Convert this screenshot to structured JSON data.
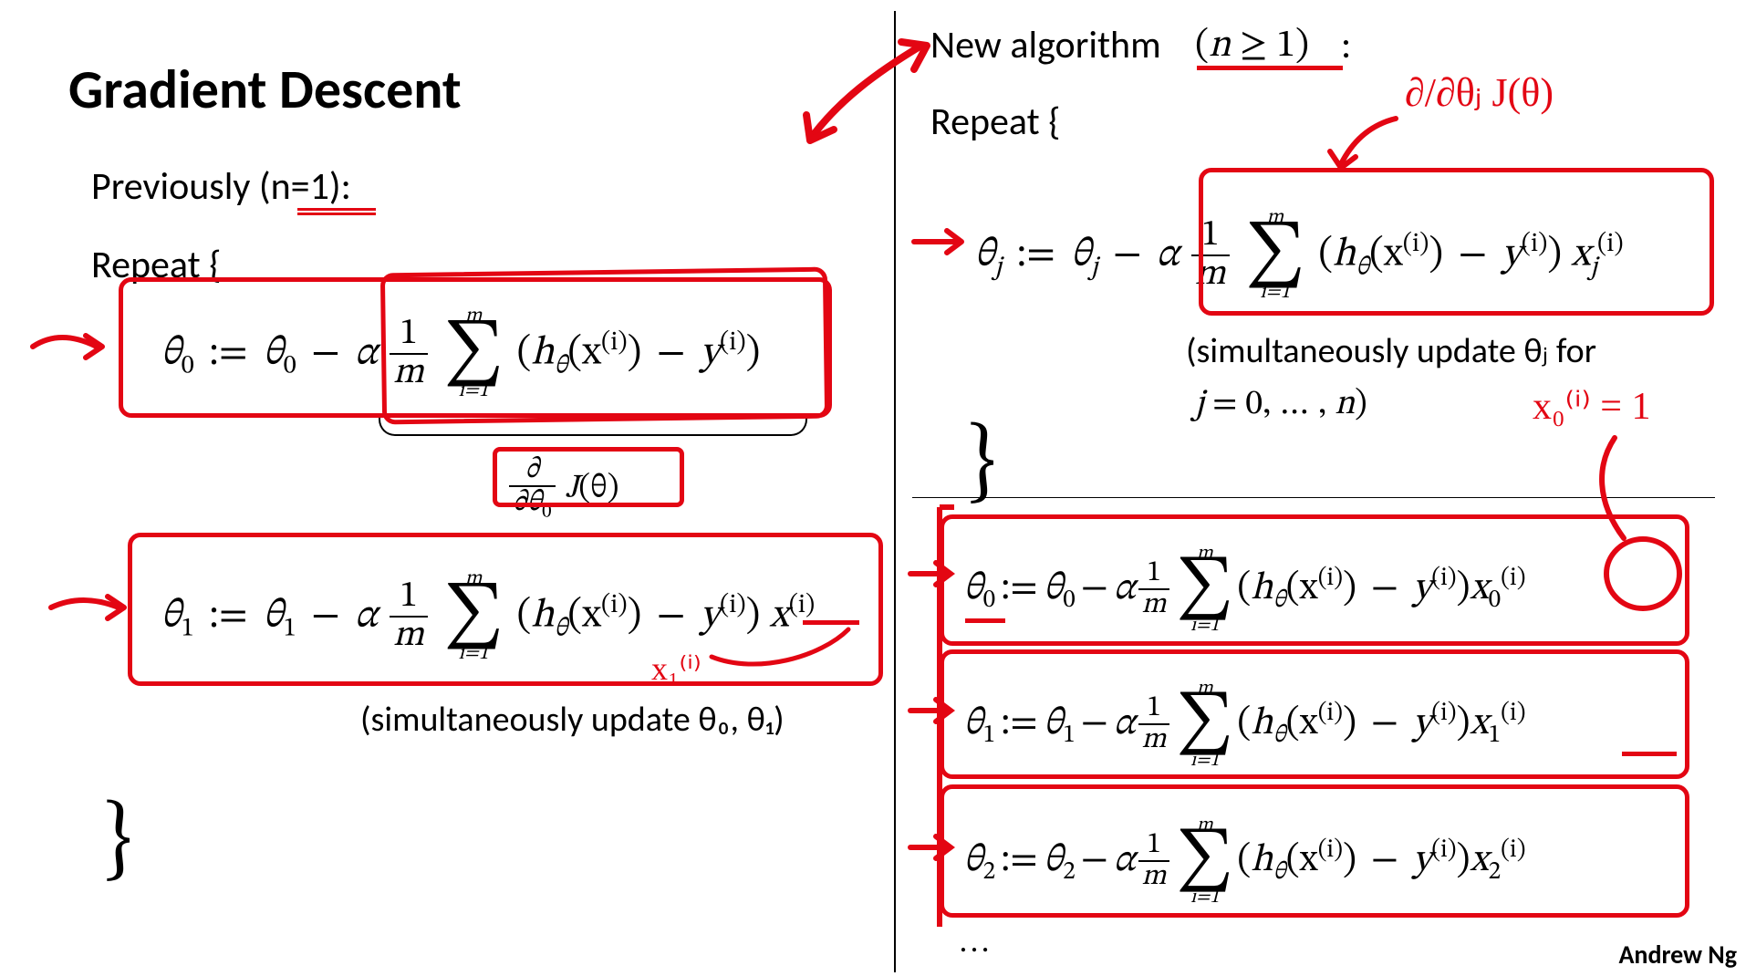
{
  "title": "Gradient Descent",
  "credit": "Andrew Ng",
  "left": {
    "header": "Previously (n=1):",
    "repeat_open": "Repeat  {",
    "eq_theta0": {
      "lhs_var": "θ",
      "lhs_sub": "0",
      "assign": ":=",
      "rhs_prefix_var": "θ",
      "rhs_prefix_sub": "0",
      "minus": "−",
      "alpha": "α",
      "frac_num": "1",
      "frac_den": "m",
      "sum_top": "m",
      "sum_bot": "i=1",
      "term_open": "(",
      "h": "h",
      "h_sub": "θ",
      "x_open": "(x",
      "x_sup": "(i)",
      "x_close": ")",
      "minus2": " − ",
      "y": "y",
      "y_sup": "(i)",
      "term_close": ")"
    },
    "deriv_label": {
      "partial": "∂",
      "partial_den_var": "∂θ",
      "partial_den_sub": "0",
      "J": "J",
      "arg": "(θ)"
    },
    "eq_theta1": {
      "lhs_var": "θ",
      "lhs_sub": "1",
      "assign": ":=",
      "rhs_prefix_var": "θ",
      "rhs_prefix_sub": "1",
      "minus": "−",
      "alpha": "α",
      "frac_num": "1",
      "frac_den": "m",
      "sum_top": "m",
      "sum_bot": "i=1",
      "term_open": "(",
      "h": "h",
      "h_sub": "θ",
      "x_open": "(x",
      "x_sup": "(i)",
      "x_close": ")",
      "minus2": " − ",
      "y": "y",
      "y_sup": "(i)",
      "term_close": ")",
      "tail_x": "x",
      "tail_sup": "(i)"
    },
    "sim_update": "(simultaneously update  θ₀, θ₁)",
    "close": "}"
  },
  "right": {
    "header_text": "New algorithm",
    "header_cond": "(n ≥ 1)",
    "header_colon": ":",
    "repeat_open": "Repeat  {",
    "eq_thetaj": {
      "lhs_var": "θ",
      "lhs_sub": "j",
      "assign": ":=",
      "rhs_prefix_var": "θ",
      "rhs_prefix_sub": "j",
      "minus": "−",
      "alpha": "α",
      "frac_num": "1",
      "frac_den": "m",
      "sum_top": "m",
      "sum_bot": "i=1",
      "term_open": "(",
      "h": "h",
      "h_sub": "θ",
      "x_open": "(x",
      "x_sup": "(i)",
      "x_close": ")",
      "minus2": " − ",
      "y": "y",
      "y_sup": "(i)",
      "term_close": ")",
      "tail_x": "x",
      "tail_sub": "j",
      "tail_sup": "(i)"
    },
    "sim_update_a": "(simultaneously update  θⱼ  for",
    "sim_update_b": "j = 0, … , n)",
    "close": "}",
    "expanded": [
      {
        "sub": "0",
        "tail_sub": "0"
      },
      {
        "sub": "1",
        "tail_sub": "1"
      },
      {
        "sub": "2",
        "tail_sub": "2"
      }
    ],
    "expanded_common": {
      "var": "θ",
      "assign": ":=",
      "minus": "−",
      "alpha": "α",
      "frac_num": "1",
      "frac_den": "m",
      "sum_top": "m",
      "sum_bot": "i=1",
      "term_open": "(",
      "h": "h",
      "h_sub": "θ",
      "x_open": "(x",
      "x_sup": "(i)",
      "x_close": ")",
      "minus2": " − ",
      "y": "y",
      "y_sup": "(i)",
      "term_close": ")",
      "tail_x": "x",
      "tail_sup": "(i)"
    },
    "ellipsis": "…"
  },
  "handwritten": {
    "partial_j": "∂/∂θⱼ J(θ)",
    "x0_eq_1": "x₀⁽ⁱ⁾ = 1",
    "x1_note": "x₁⁽ⁱ⁾"
  }
}
